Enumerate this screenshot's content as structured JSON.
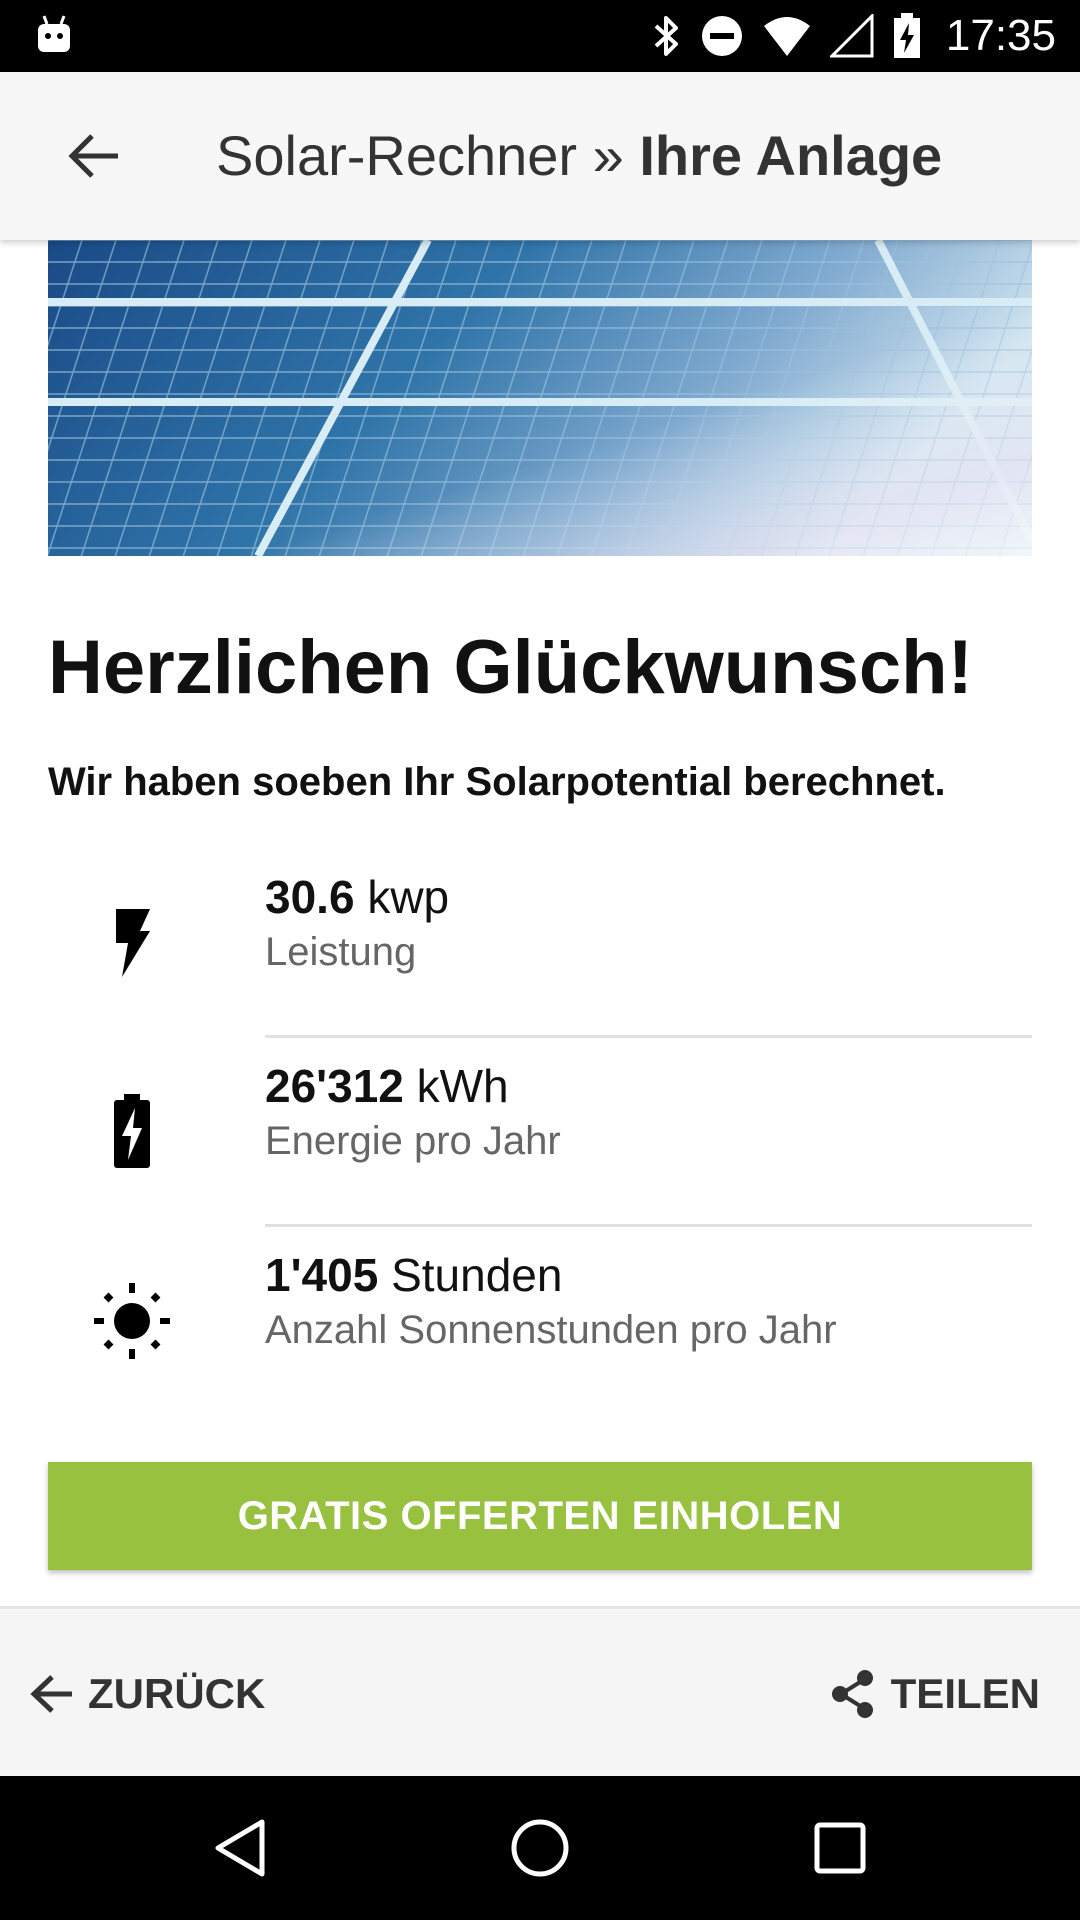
{
  "status_bar": {
    "time": "17:35",
    "icons": [
      "android-robot-icon",
      "bluetooth-icon",
      "do-not-disturb-icon",
      "wifi-icon",
      "signal-icon",
      "battery-charging-icon"
    ]
  },
  "app_bar": {
    "back_icon": "arrow-left-icon",
    "title_prefix": "Solar-Rechner » ",
    "title_main": "Ihre Anlage"
  },
  "content": {
    "headline": "Herzlichen Glückwunsch!",
    "subline": "Wir haben soeben Ihr Solarpotential berechnet.",
    "stats": [
      {
        "icon": "lightning-bolt-icon",
        "value": "30.6",
        "unit": "kwp",
        "label": "Leistung"
      },
      {
        "icon": "battery-charging-icon",
        "value": "26'312",
        "unit": "kWh",
        "label": "Energie pro Jahr"
      },
      {
        "icon": "sun-icon",
        "value": "1'405",
        "unit": "Stunden",
        "label": "Anzahl Sonnenstunden pro Jahr"
      }
    ],
    "cta_label": "GRATIS OFFERTEN EINHOLEN"
  },
  "bottom_bar": {
    "back_label": "ZURÜCK",
    "share_label": "TEILEN"
  },
  "colors": {
    "accent_green": "#97c13e",
    "app_bar_bg": "#f7f7f7",
    "secondary_text": "#666666"
  }
}
